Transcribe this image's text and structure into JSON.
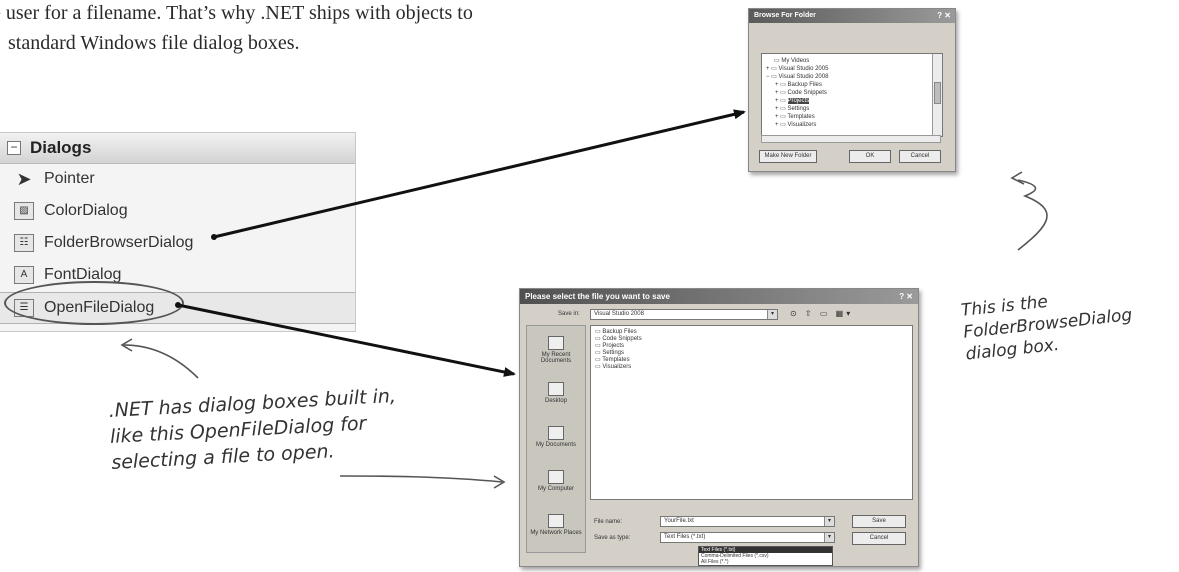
{
  "intro": {
    "line1": "e user for a filename. That’s why .NET ships with objects to",
    "line2": "standard Windows file dialog boxes."
  },
  "toolbox": {
    "title": "Dialogs",
    "items": [
      {
        "label": "Pointer",
        "icon": "pointer-icon"
      },
      {
        "label": "ColorDialog",
        "icon": "color-dialog-icon"
      },
      {
        "label": "FolderBrowserDialog",
        "icon": "folder-browser-dialog-icon"
      },
      {
        "label": "FontDialog",
        "icon": "font-dialog-icon"
      },
      {
        "label": "OpenFileDialog",
        "icon": "open-file-dialog-icon",
        "selected": true
      }
    ]
  },
  "browse_folder": {
    "title": "Browse For Folder",
    "tree": [
      "My Videos",
      "Visual Studio 2005",
      "Visual Studio 2008",
      "Backup Files",
      "Code Snippets",
      "Projects",
      "Settings",
      "Templates",
      "Visualizers"
    ],
    "selected_node": "Projects",
    "make_new_folder_label": "Make New Folder",
    "ok_label": "OK",
    "cancel_label": "Cancel"
  },
  "open_file": {
    "title": "Please select the file you want to save",
    "look_in_label": "Save in:",
    "look_in_value": "Visual Studio 2008",
    "places": [
      "My Recent Documents",
      "Desktop",
      "My Documents",
      "My Computer",
      "My Network Places"
    ],
    "files": [
      "Backup Files",
      "Code Snippets",
      "Projects",
      "Settings",
      "Templates",
      "Visualizers"
    ],
    "file_name_label": "File name:",
    "file_name_value": "YourFile.txt",
    "file_type_label": "Save as type:",
    "file_type_value": "Text Files (*.txt)",
    "save_label": "Save",
    "cancel_label": "Cancel",
    "type_options": [
      "Text Files (*.txt)",
      "Comma-Delimited Files (*.csv)",
      "All Files (*.*)"
    ]
  },
  "notes": {
    "openfile_line1": ".NET has dialog boxes built in,",
    "openfile_line2": "like this OpenFileDialog for",
    "openfile_line3": "selecting a file to open.",
    "folder_line1": "This is the",
    "folder_line2": "FolderBrowseDialog",
    "folder_line3": "dialog box."
  }
}
